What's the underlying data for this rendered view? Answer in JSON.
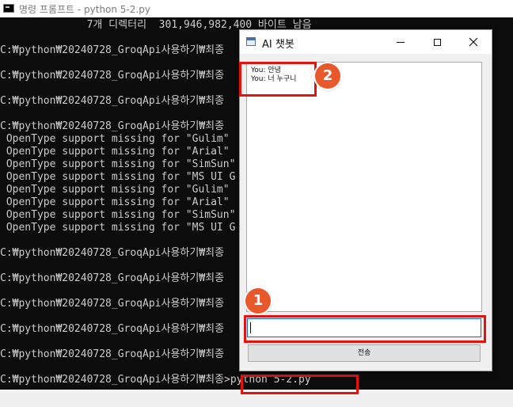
{
  "console": {
    "title": "명령 프롬프트 - python  5-2.py",
    "lines": [
      "              7개 디렉터리  301,946,982,400 바이트 남음",
      "",
      "C:₩python₩20240728_GroqApi사용하기₩최종",
      "",
      "C:₩python₩20240728_GroqApi사용하기₩최종",
      "",
      "C:₩python₩20240728_GroqApi사용하기₩최종",
      "",
      "C:₩python₩20240728_GroqApi사용하기₩최종",
      " OpenType support missing for \"Gulim\"",
      " OpenType support missing for \"Arial\"",
      " OpenType support missing for \"SimSun\"",
      " OpenType support missing for \"MS UI G",
      " OpenType support missing for \"Gulim\"",
      " OpenType support missing for \"Arial\"",
      " OpenType support missing for \"SimSun\"",
      " OpenType support missing for \"MS UI G",
      "",
      "C:₩python₩20240728_GroqApi사용하기₩최종",
      "",
      "C:₩python₩20240728_GroqApi사용하기₩최종",
      "",
      "C:₩python₩20240728_GroqApi사용하기₩최종",
      "",
      "C:₩python₩20240728_GroqApi사용하기₩최종",
      "",
      "C:₩python₩20240728_GroqApi사용하기₩최종",
      "",
      "C:₩python₩20240728_GroqApi사용하기₩최종>python 5-2.py"
    ],
    "command": ">python 5-2.py"
  },
  "chat": {
    "title": "AI 챗봇",
    "messages": [
      "You: 안녕",
      "You: 너 누구니"
    ],
    "input_value": "",
    "send_label": "전송"
  },
  "annotations": {
    "badge_1": "1",
    "badge_2": "2",
    "color": "#e3140f",
    "badge_color": "#e8582a"
  }
}
